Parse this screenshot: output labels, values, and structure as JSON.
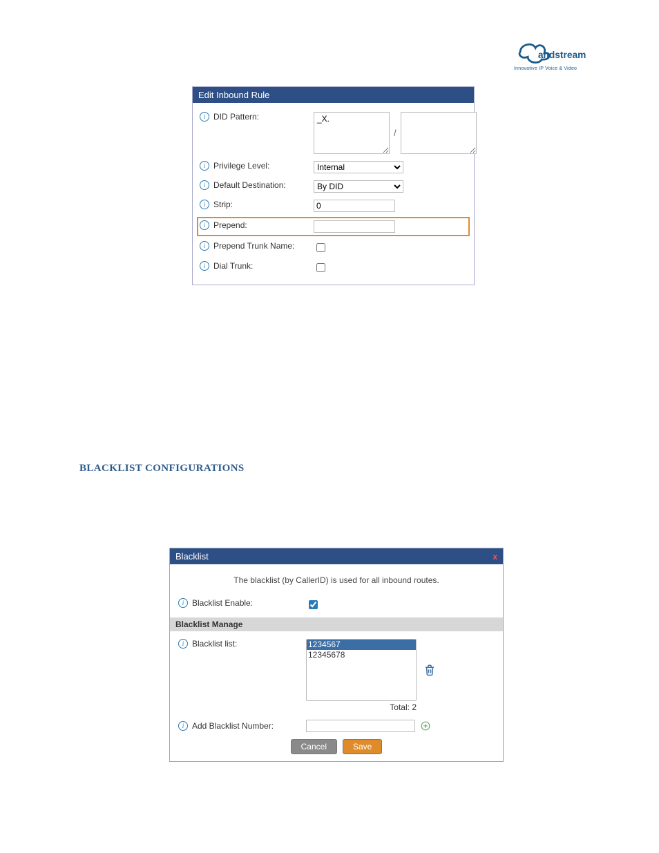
{
  "logo": {
    "brand": "Grandstream",
    "tagline": "Innovative IP Voice & Video"
  },
  "inbound_panel": {
    "title": "Edit Inbound Rule",
    "rows": {
      "did_pattern": {
        "label": "DID Pattern:",
        "value_a": "_X.",
        "value_b": ""
      },
      "privilege": {
        "label": "Privilege Level:",
        "value": "Internal"
      },
      "dest": {
        "label": "Default Destination:",
        "value": "By DID"
      },
      "strip": {
        "label": "Strip:",
        "value": "0"
      },
      "prepend": {
        "label": "Prepend:",
        "value": ""
      },
      "prepend_trunk": {
        "label": "Prepend Trunk Name:",
        "checked": false
      },
      "dial_trunk": {
        "label": "Dial Trunk:",
        "checked": false
      }
    }
  },
  "section_heading": "BLACKLIST CONFIGURATIONS",
  "blacklist_dialog": {
    "title": "Blacklist",
    "close": "x",
    "note": "The blacklist (by CallerID) is used for all inbound routes.",
    "enable_label": "Blacklist Enable:",
    "enable_checked": true,
    "manage_header": "Blacklist Manage",
    "list_label": "Blacklist list:",
    "list_items": [
      "1234567",
      "12345678"
    ],
    "selected_index": 0,
    "total_prefix": "Total: ",
    "total_value": "2",
    "add_label": "Add Blacklist Number:",
    "add_value": "",
    "cancel": "Cancel",
    "save": "Save"
  }
}
